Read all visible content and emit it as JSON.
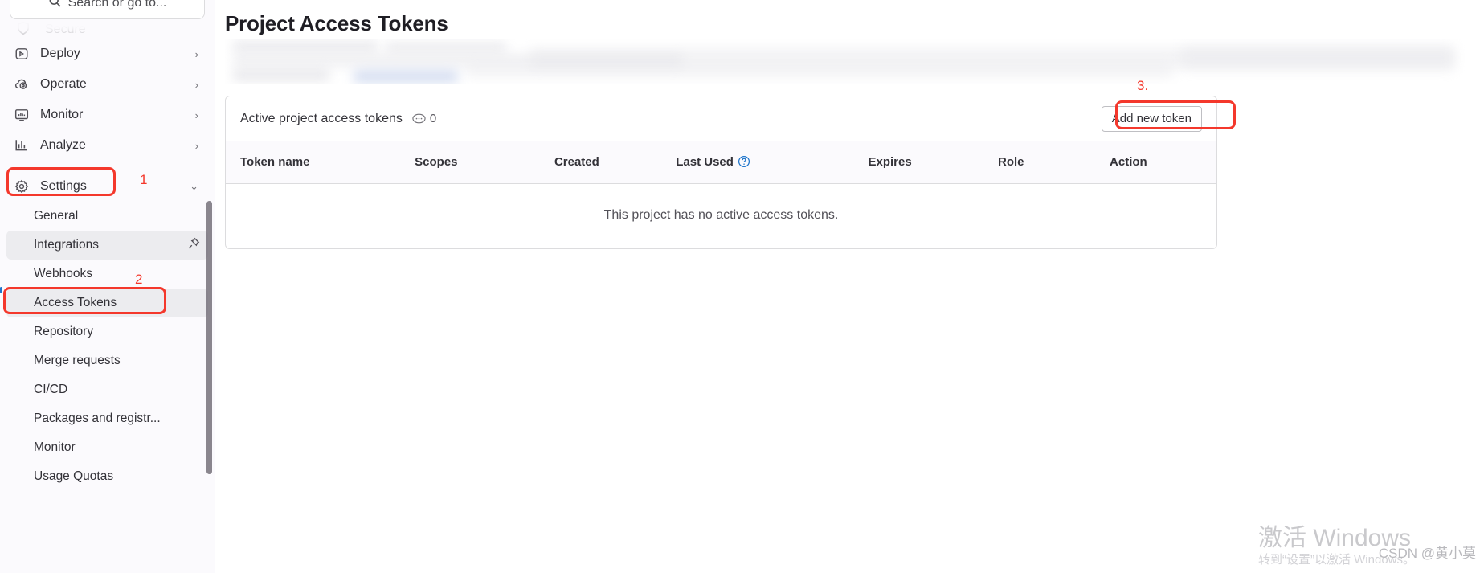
{
  "sidebar": {
    "search": {
      "placeholder": "Search or go to...",
      "icon": "search-icon"
    },
    "ghost_item": {
      "label": "Secure",
      "icon": "shield-icon"
    },
    "nav_items": [
      {
        "label": "Deploy",
        "icon": "rocket-icon",
        "chevron": "›"
      },
      {
        "label": "Operate",
        "icon": "cloud-icon",
        "chevron": "›"
      },
      {
        "label": "Monitor",
        "icon": "monitor-icon",
        "chevron": "›"
      },
      {
        "label": "Analyze",
        "icon": "chart-icon",
        "chevron": "›"
      },
      {
        "label": "Settings",
        "icon": "gear-icon",
        "chevron": "⌄"
      }
    ],
    "sub_items": [
      {
        "label": "General"
      },
      {
        "label": "Integrations",
        "pinned": true
      },
      {
        "label": "Webhooks"
      },
      {
        "label": "Access Tokens",
        "current": true
      },
      {
        "label": "Repository"
      },
      {
        "label": "Merge requests"
      },
      {
        "label": "CI/CD"
      },
      {
        "label": "Packages and registr..."
      },
      {
        "label": "Monitor"
      },
      {
        "label": "Usage Quotas"
      }
    ]
  },
  "annotations": {
    "step1": "1",
    "step2": "2",
    "step3": "3.",
    "color": "#f4382c"
  },
  "main": {
    "page_title": "Project Access Tokens",
    "card": {
      "title": "Active project access tokens",
      "count": "0",
      "count_icon": "token-icon",
      "add_button": "Add new token"
    },
    "table": {
      "headers": [
        {
          "label": "Token name"
        },
        {
          "label": "Scopes"
        },
        {
          "label": "Created"
        },
        {
          "label": "Last Used",
          "help_icon": "question-circle-icon"
        },
        {
          "label": "Expires"
        },
        {
          "label": "Role"
        },
        {
          "label": "Action"
        }
      ],
      "empty_message": "This project has no active access tokens.",
      "rows": []
    }
  },
  "watermarks": {
    "windows_line1": "激活 Windows",
    "windows_line2": "转到“设置”以激活 Windows。",
    "csdn": "CSDN @黄小莫"
  }
}
